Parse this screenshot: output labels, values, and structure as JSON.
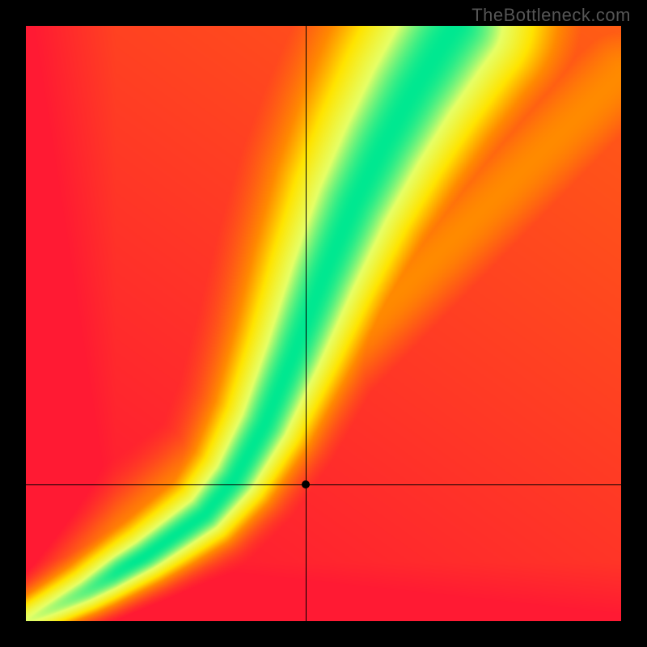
{
  "watermark": "TheBottleneck.com",
  "chart_data": {
    "type": "heatmap",
    "title": "",
    "xlabel": "",
    "ylabel": "",
    "xlim": [
      0,
      100
    ],
    "ylim": [
      0,
      100
    ],
    "crosshair": {
      "x": 47,
      "y": 23
    },
    "marker": {
      "x": 47,
      "y": 23
    },
    "optimal_curve": {
      "description": "Green optimal-match ridge through the heatmap",
      "points": [
        {
          "x": 0,
          "y": 0
        },
        {
          "x": 10,
          "y": 5
        },
        {
          "x": 20,
          "y": 11
        },
        {
          "x": 30,
          "y": 18
        },
        {
          "x": 35,
          "y": 24
        },
        {
          "x": 40,
          "y": 33
        },
        {
          "x": 45,
          "y": 45
        },
        {
          "x": 50,
          "y": 58
        },
        {
          "x": 55,
          "y": 70
        },
        {
          "x": 60,
          "y": 80
        },
        {
          "x": 65,
          "y": 89
        },
        {
          "x": 70,
          "y": 97
        },
        {
          "x": 72,
          "y": 100
        }
      ]
    },
    "colorscale": [
      {
        "stop": 0.0,
        "color": "#ff1a33"
      },
      {
        "stop": 0.35,
        "color": "#ff8a00"
      },
      {
        "stop": 0.55,
        "color": "#ffe400"
      },
      {
        "stop": 0.8,
        "color": "#e6ff66"
      },
      {
        "stop": 1.0,
        "color": "#00e890"
      }
    ],
    "secondary_ridge": {
      "description": "Faint yellow secondary diagonal toward upper-right",
      "intensity": 0.35,
      "points": [
        {
          "x": 0,
          "y": 0
        },
        {
          "x": 50,
          "y": 43
        },
        {
          "x": 100,
          "y": 92
        }
      ]
    },
    "global_gradient": {
      "description": "Mild warm lift toward upper-right corner",
      "strength": 0.2
    }
  }
}
